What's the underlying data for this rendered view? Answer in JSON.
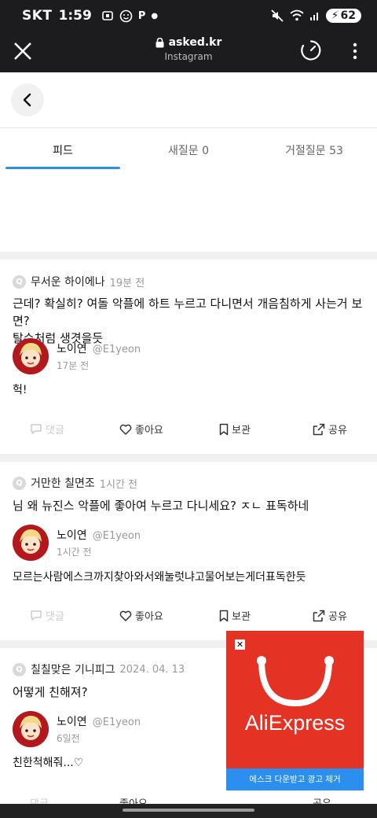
{
  "status_bar": {
    "carrier": "SKT",
    "time": "1:59",
    "icons": [
      "screenshot-icon",
      "face-icon",
      "p-icon",
      "dot-icon"
    ],
    "p_label": "P",
    "battery": "62"
  },
  "browser": {
    "domain": "asked.kr",
    "subtitle": "Instagram"
  },
  "tabs": [
    {
      "label": "피드",
      "active": true
    },
    {
      "label": "새질문 0",
      "active": false
    },
    {
      "label": "거절질문 53",
      "active": false
    }
  ],
  "posts": [
    {
      "asker": "무서운 하이에나",
      "asked_time": "19분 전",
      "question_lines": [
        "근데? 확실히? 여돌 악플에 하트 누르고 다니면서 개음침하게 사는거 보면?",
        "탈수처럼 생겻을듯"
      ],
      "author_name": "노이연",
      "author_handle": "@E1yeon",
      "answered_time": "17분 전",
      "answer": "헉!"
    },
    {
      "asker": "거만한 칠면조",
      "asked_time": "1시간 전",
      "question_lines": [
        "님 왜 뉴진스 악플에 좋아여 누르고 다니세요? ㅈㄴ 표독하네"
      ],
      "author_name": "노이연",
      "author_handle": "@E1yeon",
      "answered_time": "1시간 전",
      "answer": "모르는사람에스크까지찾아와서왜눌럿냐고물어보는게더표독한듯"
    },
    {
      "asker": "칠칠맞은 기니피그",
      "asked_time": "2024. 04. 13",
      "question_lines": [
        "어떻게 친해져?"
      ],
      "author_name": "노이연",
      "author_handle": "@E1yeon",
      "answered_time": "6일전",
      "answer": "친한척해줘...♡"
    }
  ],
  "actions": {
    "comment": "댓글",
    "like": "좋아요",
    "bookmark": "보관",
    "share": "공유"
  },
  "ad": {
    "brand": "AliExpress",
    "cta": "에스크 다운받고 광고 제거",
    "close": "✕"
  }
}
